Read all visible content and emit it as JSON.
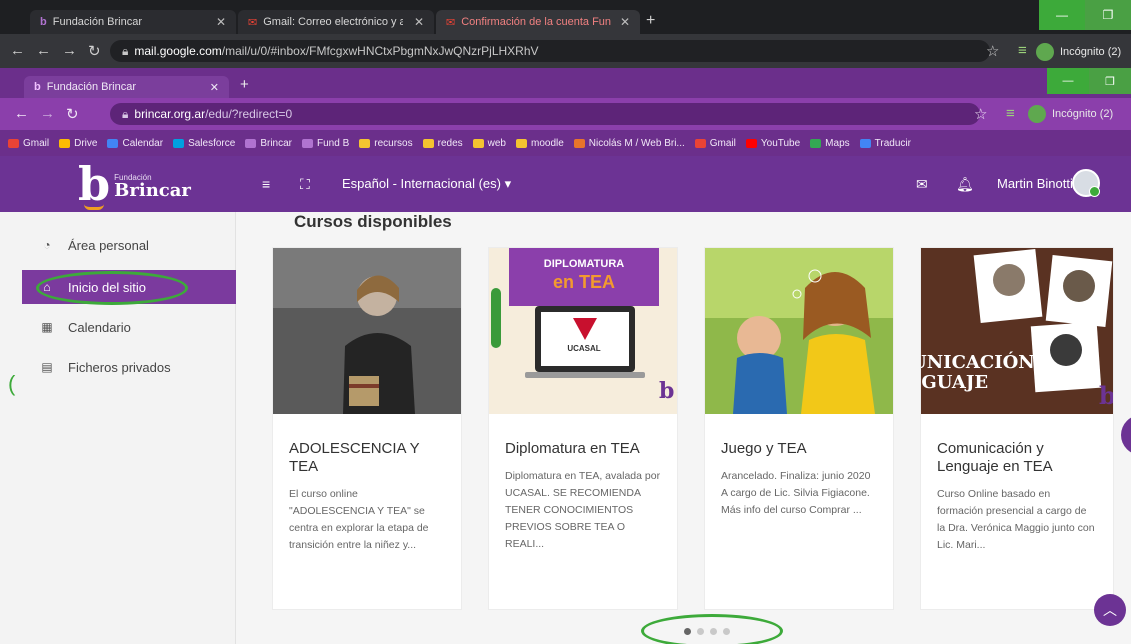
{
  "outer_browser": {
    "tabs": [
      {
        "label": "Fundación Brincar"
      },
      {
        "label": "Gmail: Correo electrónico y alma"
      },
      {
        "label": "Confirmación de la cuenta Funda"
      }
    ],
    "url_host": "mail.google.com",
    "url_path": "/mail/u/0/#inbox/FMfcgxwHNCtxPbgmNxJwQNzrPjLHXRhV",
    "incognito": "Incógnito (2)"
  },
  "inner_browser": {
    "tab_label": "Fundación Brincar",
    "url_host": "brincar.org.ar",
    "url_path": "/edu/?redirect=0",
    "incognito": "Incógnito (2)",
    "bookmarks": [
      {
        "label": "Gmail",
        "color": "#ea4335"
      },
      {
        "label": "Drive",
        "color": "#fbbc04"
      },
      {
        "label": "Calendar",
        "color": "#4285f4"
      },
      {
        "label": "Salesforce",
        "color": "#00a1e0"
      },
      {
        "label": "Brincar",
        "color": "#b073d0"
      },
      {
        "label": "Fund B",
        "color": "#b073d0"
      },
      {
        "label": "recursos",
        "color": "#f4c430"
      },
      {
        "label": "redes",
        "color": "#f4c430"
      },
      {
        "label": "web",
        "color": "#f4c430"
      },
      {
        "label": "moodle",
        "color": "#f4c430"
      },
      {
        "label": "Nicolás M / Web Bri...",
        "color": "#e8742a"
      },
      {
        "label": "Gmail",
        "color": "#ea4335"
      },
      {
        "label": "YouTube",
        "color": "#ff0000"
      },
      {
        "label": "Maps",
        "color": "#34a853"
      },
      {
        "label": "Traducir",
        "color": "#4285f4"
      }
    ]
  },
  "site": {
    "logo_small": "Fundación",
    "logo_letter": "b",
    "logo_name": "Brincar",
    "language": "Español - Internacional (es) ▾",
    "user_name": "Martin Binotti"
  },
  "sidebar": {
    "items": [
      {
        "label": "Área personal",
        "icon": "dashboard-icon"
      },
      {
        "label": "Inicio del sitio",
        "icon": "home-icon"
      },
      {
        "label": "Calendario",
        "icon": "calendar-icon"
      },
      {
        "label": "Ficheros privados",
        "icon": "files-icon"
      }
    ]
  },
  "main": {
    "section_title": "Cursos disponibles",
    "courses": [
      {
        "title": "ADOLESCENCIA Y TEA",
        "description": "El curso online \"ADOLESCENCIA Y TEA\" se centra en explorar la etapa de transición entre la niñez y..."
      },
      {
        "title": "Diplomatura en TEA",
        "description": "Diplomatura en TEA, avalada por UCASAL. SE RECOMIENDA TENER CONOCIMIENTOS PREVIOS SOBRE TEA O REALI...",
        "image_text_1": "DIPLOMATURA",
        "image_text_2": "en TEA",
        "image_text_3": "UCASAL"
      },
      {
        "title": "Juego y TEA",
        "description": "Arancelado.  Finaliza: junio 2020 A cargo de Lic. Silvia Figiacone. Más info del curso Comprar ..."
      },
      {
        "title": "Comunicación y Lenguaje en TEA",
        "description": "Curso Online basado en formación presencial a cargo de la Dra. Verónica Maggio junto con Lic. Mari...",
        "image_text_1": "UNICACIÓN",
        "image_text_2": "IGUAJE"
      }
    ],
    "carousel_active": 0,
    "carousel_pages": 4
  },
  "colors": {
    "brand_purple": "#6c3394",
    "highlight_green": "#3daa3a"
  }
}
